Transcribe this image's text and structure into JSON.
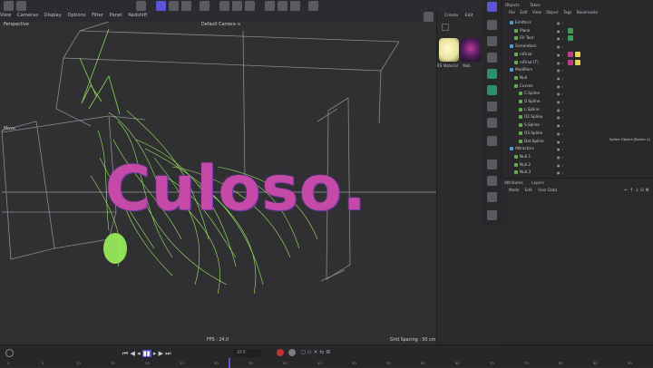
{
  "menu": [
    "View",
    "Cameras",
    "Display",
    "Options",
    "Filter",
    "Panel",
    "Redshift"
  ],
  "viewport": {
    "mode": "Perspective",
    "camera": "Default Camera ⊙",
    "move_label": "Move",
    "fps": "FPS : 24.0",
    "grid": "Grid Spacing : 50 cm"
  },
  "material_manager": {
    "header": [
      "Create",
      "Edit"
    ],
    "materials": [
      "RS Material",
      "Web"
    ]
  },
  "objects_panel": {
    "tabs": [
      "Objects",
      "Takes"
    ],
    "menu": [
      "File",
      "Edit",
      "View",
      "Object",
      "Tags",
      "Bookmarks"
    ],
    "rows": [
      {
        "name": "Emitters",
        "indent": 0
      },
      {
        "name": "Plane",
        "indent": 1
      },
      {
        "name": "Fill Text",
        "indent": 1
      },
      {
        "name": "Generators",
        "indent": 0
      },
      {
        "name": "rsFinal",
        "indent": 1
      },
      {
        "name": "rsFinal (T)",
        "indent": 1
      },
      {
        "name": "Modifiers",
        "indent": 0
      },
      {
        "name": "Null",
        "indent": 1
      },
      {
        "name": "Curves",
        "indent": 1
      },
      {
        "name": "C.Spline",
        "indent": 2
      },
      {
        "name": "O.Spline",
        "indent": 2
      },
      {
        "name": "L.Spline",
        "indent": 2
      },
      {
        "name": "O2.Spline",
        "indent": 2
      },
      {
        "name": "S.Spline",
        "indent": 2
      },
      {
        "name": "O3.Spline",
        "indent": 2
      },
      {
        "name": "Dot.Spline",
        "indent": 2
      },
      {
        "name": "Attractors",
        "indent": 0
      },
      {
        "name": "Null.1",
        "indent": 1
      },
      {
        "name": "Null.2",
        "indent": 1
      },
      {
        "name": "Null.3",
        "indent": 1
      }
    ],
    "tooltip": "Spline Object [Spline.1]"
  },
  "attributes_panel": {
    "tab": "Attributes",
    "sub": "Layers",
    "menu": [
      "Mode",
      "Edit",
      "User Data"
    ]
  },
  "scene_text": "Culoso.",
  "timeline": {
    "frame": "37 F",
    "start": "0 F",
    "end": "90 F",
    "ticks": [
      "0",
      "5",
      "10",
      "15",
      "20",
      "25",
      "30",
      "35",
      "40",
      "45",
      "50",
      "55",
      "60",
      "65",
      "70",
      "75",
      "80",
      "85",
      "90"
    ]
  },
  "colors": {
    "accent": "#5b54d6",
    "fibers": "#9cf25c",
    "letters_a": "#c54aa8",
    "letters_b": "#6a3aa8"
  }
}
